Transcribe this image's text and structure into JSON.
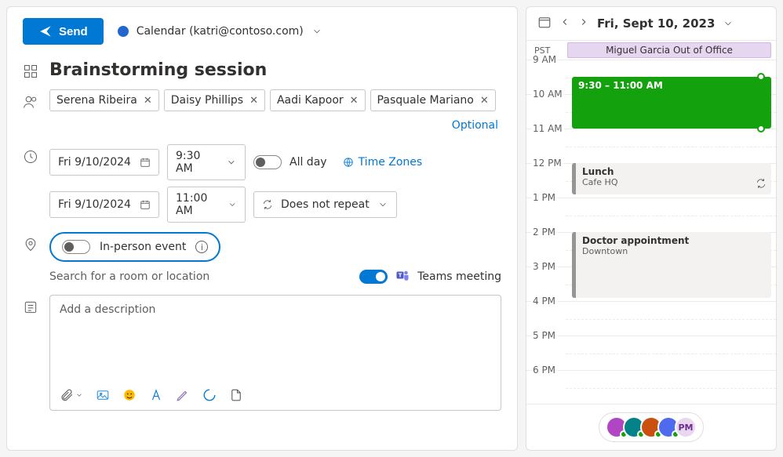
{
  "header": {
    "send": "Send",
    "calendar_label": "Calendar (katri@contoso.com)"
  },
  "event": {
    "title": "Brainstorming session",
    "attendees": [
      "Serena Ribeira",
      "Daisy Phillips",
      "Aadi Kapoor",
      "Pasquale Mariano"
    ],
    "optional_label": "Optional",
    "start_date": "Fri 9/10/2024",
    "start_time": "9:30 AM",
    "end_date": "Fri 9/10/2024",
    "end_time": "11:00 AM",
    "all_day_label": "All day",
    "time_zones_label": "Time Zones",
    "repeat_label": "Does not repeat",
    "in_person_label": "In-person event",
    "location_hint": "Search for a room or location",
    "teams_label": "Teams meeting",
    "description_placeholder": "Add a description"
  },
  "calendar": {
    "date_label": "Fri, Sept 10, 2023",
    "tz": "PST",
    "oof": "Miguel Garcia Out of Office",
    "hours": [
      "9 AM",
      "10 AM",
      "11 AM",
      "12 PM",
      "1 PM",
      "2 PM",
      "3 PM",
      "4 PM",
      "5 PM",
      "6 PM"
    ],
    "ev_green_time": "9:30 – 11:00 AM",
    "ev_lunch_title": "Lunch",
    "ev_lunch_sub": "Cafe HQ",
    "ev_doc_title": "Doctor appointment",
    "ev_doc_sub": "Downtown",
    "avatars": [
      {
        "bg": "#b146c2",
        "initials": ""
      },
      {
        "bg": "#038387",
        "initials": ""
      },
      {
        "bg": "#ca5010",
        "initials": ""
      },
      {
        "bg": "#4f6bed",
        "initials": ""
      },
      {
        "bg": "#e8d7ef",
        "initials": "PM",
        "fg": "#6b2e8f"
      }
    ]
  }
}
